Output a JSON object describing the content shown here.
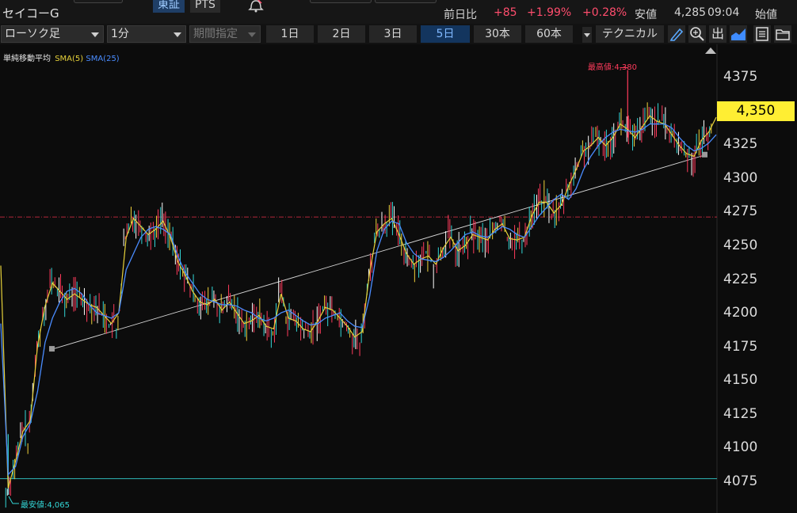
{
  "header": {
    "stock_name": "セイコーG",
    "exchange_tabs": [
      {
        "label": "東証",
        "active": true
      },
      {
        "label": "PTS",
        "active": false
      }
    ],
    "quote": {
      "prev_day_label": "前日比",
      "change": "+85",
      "change_pct": "+1.99%",
      "sub_change_pct": "+0.28%",
      "low_label": "安値",
      "low_value": "4,285",
      "time": "09:04",
      "open_label": "始値"
    }
  },
  "toolbar": {
    "chart_type": "ローソク足",
    "interval": "1分",
    "period_specify": "期間指定",
    "periods": [
      {
        "label": "1日",
        "selected": false
      },
      {
        "label": "2日",
        "selected": false
      },
      {
        "label": "3日",
        "selected": false
      },
      {
        "label": "5日",
        "selected": true
      },
      {
        "label": "30本",
        "selected": false
      },
      {
        "label": "60本",
        "selected": false
      }
    ],
    "technical_label": "テクニカル",
    "icons": [
      "draw-pen-icon",
      "zoom-icon",
      "output-icon",
      "area-chart-icon",
      "save-icon",
      "folder-icon"
    ],
    "output_label": "出"
  },
  "chart_data": {
    "type": "line",
    "legend": {
      "indicator": "単純移動平均",
      "series": [
        {
          "name": "SMA(5)",
          "color": "#e6d13a"
        },
        {
          "name": "SMA(25)",
          "color": "#4a8cff"
        }
      ]
    },
    "y_ticks": [
      4375,
      4350,
      4325,
      4300,
      4275,
      4250,
      4225,
      4200,
      4175,
      4150,
      4125,
      4100,
      4075
    ],
    "ylim": [
      4062,
      4394
    ],
    "current_price": "4,350",
    "current_price_value": 4350,
    "high_label": "最高値:4,380",
    "high_value": 4380,
    "low_label": "最安値:4,065",
    "low_value": 4065,
    "reference_line_value": 4271,
    "low_line_value": 4077,
    "trendline": {
      "from": 4173,
      "to": 4317
    },
    "sma25": [
      4192,
      4080,
      4086,
      4108,
      4118,
      4142,
      4178,
      4196,
      4208,
      4216,
      4218,
      4214,
      4206,
      4200,
      4198,
      4196,
      4200,
      4232,
      4244,
      4256,
      4262,
      4264,
      4262,
      4258,
      4242,
      4230,
      4222,
      4214,
      4210,
      4208,
      4206,
      4206,
      4205,
      4202,
      4200,
      4196,
      4194,
      4196,
      4200,
      4202,
      4198,
      4194,
      4191,
      4192,
      4196,
      4198,
      4200,
      4194,
      4190,
      4189,
      4212,
      4246,
      4262,
      4268,
      4266,
      4252,
      4244,
      4240,
      4239,
      4238,
      4241,
      4246,
      4252,
      4258,
      4260,
      4257,
      4256,
      4260,
      4264,
      4262,
      4258,
      4256,
      4264,
      4272,
      4278,
      4284,
      4288,
      4284,
      4292,
      4306,
      4316,
      4324,
      4330,
      4334,
      4336,
      4335,
      4334,
      4336,
      4340,
      4340,
      4340,
      4337,
      4330,
      4324,
      4320,
      4322,
      4326,
      4332
    ],
    "sma5": [
      4235,
      4070,
      4090,
      4112,
      4120,
      4176,
      4205,
      4222,
      4216,
      4210,
      4214,
      4210,
      4206,
      4204,
      4198,
      4192,
      4200,
      4256,
      4270,
      4264,
      4258,
      4262,
      4268,
      4256,
      4238,
      4228,
      4216,
      4208,
      4206,
      4210,
      4202,
      4208,
      4200,
      4192,
      4194,
      4198,
      4190,
      4188,
      4214,
      4196,
      4194,
      4188,
      4186,
      4194,
      4204,
      4202,
      4196,
      4190,
      4182,
      4186,
      4230,
      4260,
      4266,
      4270,
      4258,
      4244,
      4236,
      4240,
      4242,
      4236,
      4248,
      4256,
      4246,
      4250,
      4258,
      4256,
      4254,
      4262,
      4266,
      4255,
      4254,
      4256,
      4272,
      4282,
      4282,
      4274,
      4280,
      4294,
      4306,
      4320,
      4324,
      4330,
      4324,
      4330,
      4340,
      4336,
      4330,
      4338,
      4346,
      4342,
      4340,
      4332,
      4324,
      4318,
      4316,
      4328,
      4334,
      4345
    ]
  }
}
